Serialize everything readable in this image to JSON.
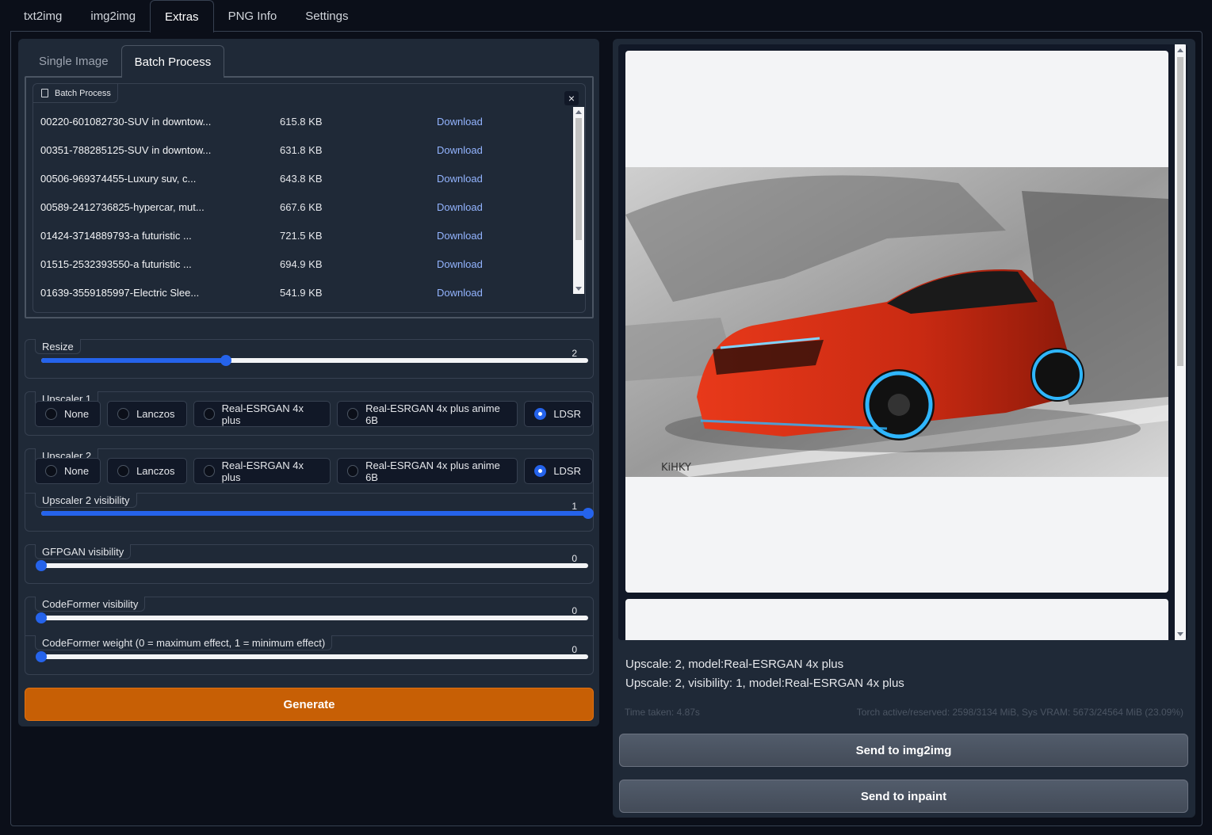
{
  "top_tabs": [
    "txt2img",
    "img2img",
    "Extras",
    "PNG Info",
    "Settings"
  ],
  "sub_tabs": [
    "Single Image",
    "Batch Process"
  ],
  "batch": {
    "label": "Batch Process",
    "close": "×",
    "files": [
      {
        "name": "00220-601082730-SUV in downtow...",
        "size": "615.8 KB",
        "link": "Download"
      },
      {
        "name": "00351-788285125-SUV in downtow...",
        "size": "631.8 KB",
        "link": "Download"
      },
      {
        "name": "00506-969374455-Luxury suv, c...",
        "size": "643.8 KB",
        "link": "Download"
      },
      {
        "name": "00589-2412736825-hypercar, mut...",
        "size": "667.6 KB",
        "link": "Download"
      },
      {
        "name": "01424-3714889793-a futuristic ...",
        "size": "721.5 KB",
        "link": "Download"
      },
      {
        "name": "01515-2532393550-a futuristic ...",
        "size": "694.9 KB",
        "link": "Download"
      },
      {
        "name": "01639-3559185997-Electric Slee...",
        "size": "541.9 KB",
        "link": "Download"
      }
    ]
  },
  "resize": {
    "label": "Resize",
    "value": "2",
    "fraction": 0.337
  },
  "upscaler1": {
    "label": "Upscaler 1",
    "options": [
      "None",
      "Lanczos",
      "Real-ESRGAN 4x plus",
      "Real-ESRGAN 4x plus anime 6B",
      "LDSR"
    ],
    "selected": "LDSR"
  },
  "upscaler2": {
    "label": "Upscaler 2",
    "options": [
      "None",
      "Lanczos",
      "Real-ESRGAN 4x plus",
      "Real-ESRGAN 4x plus anime 6B",
      "LDSR"
    ],
    "selected": "LDSR"
  },
  "upscaler2_visibility": {
    "label": "Upscaler 2 visibility",
    "value": "1",
    "fraction": 1.0
  },
  "gfpgan": {
    "label": "GFPGAN visibility",
    "value": "0",
    "fraction": 0
  },
  "codeformer_visibility": {
    "label": "CodeFormer visibility",
    "value": "0",
    "fraction": 0
  },
  "codeformer_weight": {
    "label": "CodeFormer weight (0 = maximum effect, 1 = minimum effect)",
    "value": "0",
    "fraction": 0
  },
  "generate_label": "Generate",
  "output": {
    "info_line1": "Upscale: 2, model:Real-ESRGAN 4x plus",
    "info_line2": "Upscale: 2, visibility: 1, model:Real-ESRGAN 4x plus",
    "time_taken": "Time taken: 4.87s",
    "vram": "Torch active/reserved: 2598/3134 MiB, Sys VRAM: 5673/24564 MiB (23.09%)",
    "signature": "KiHKY"
  },
  "send_img2img": "Send to img2img",
  "send_inpaint": "Send to inpaint",
  "colors": {
    "accent": "#2563eb",
    "generate": "#c75f05",
    "link": "#93b4ff"
  }
}
